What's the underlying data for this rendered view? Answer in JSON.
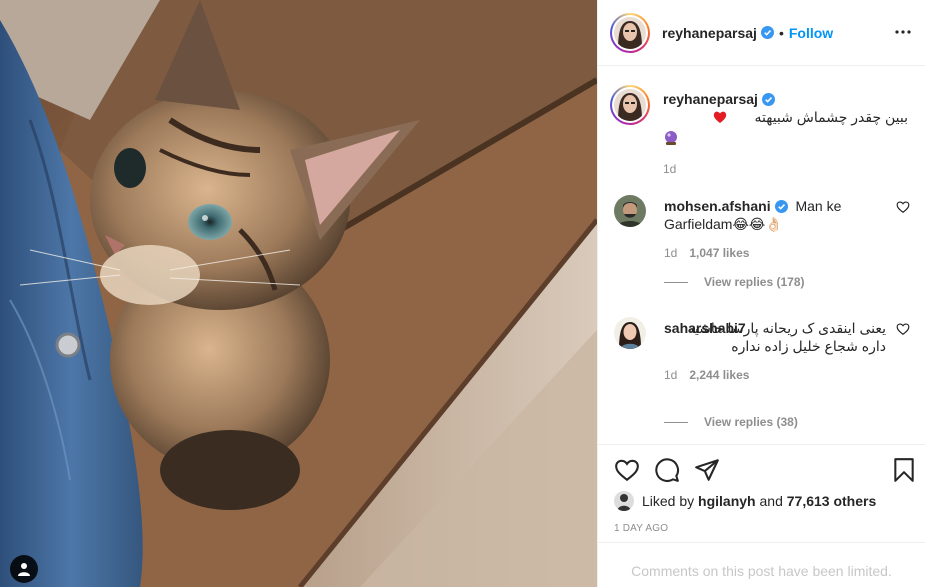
{
  "post": {
    "author": "reyhaneparsaj",
    "follow_label": "Follow",
    "separator": "•",
    "caption_line1": "ببین چقدر چشماش شبیهته",
    "caption_age": "1d",
    "image_icon": "user-tag-icon"
  },
  "comments": [
    {
      "username": "mohsen.afshani",
      "verified": true,
      "text": "Man ke Garfieldam😂😂👌🏻",
      "age": "1d",
      "likes": "1,047 likes",
      "view_replies": "View replies (178)"
    },
    {
      "username": "saharshabi7",
      "verified": false,
      "text": "یعنی اینقدی ک ریحانه پارسا حاشیه داره شجاع خلیل زاده نداره",
      "age": "1d",
      "likes": "2,244 likes",
      "view_replies": "View replies (38)"
    }
  ],
  "footer": {
    "liked_by_prefix": "Liked by",
    "liked_by_user": "hgilanyh",
    "and": "and",
    "others": "77,613 others",
    "time_ago": "1 DAY AGO",
    "limited_notice": "Comments on this post have been limited."
  },
  "icons": [
    "more-options-icon",
    "verified-badge-icon",
    "heart-icon",
    "comment-icon",
    "share-icon",
    "bookmark-icon",
    "comment-like-icon"
  ],
  "colors": {
    "accent": "#0095f6",
    "text": "#262626",
    "muted": "#8e8e8e",
    "border": "#efefef",
    "limited": "#c7c7c7",
    "heart": "#ed4956"
  }
}
